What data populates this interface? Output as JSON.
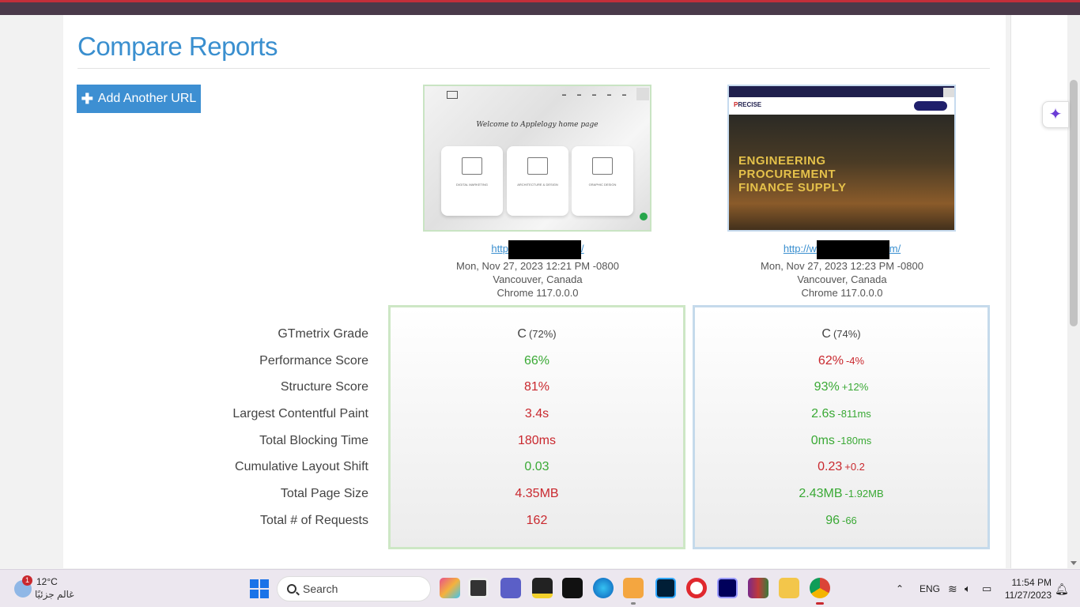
{
  "page": {
    "title": "Compare Reports",
    "add_url_label": "Add Another URL"
  },
  "reports": [
    {
      "url_prefix": "http",
      "url_suffix": "/",
      "datetime": "Mon, Nov 27, 2023 12:21 PM -0800",
      "location": "Vancouver, Canada",
      "browser": "Chrome 117.0.0.0",
      "thumbnail": {
        "headline": "Welcome to Applelogy home page",
        "cards": [
          "DIGITAL MARKETING",
          "ARCHITECTURE & DESIGN",
          "GRAPHIC DESIGN"
        ]
      }
    },
    {
      "url_prefix": "http://w",
      "url_suffix": "m/",
      "datetime": "Mon, Nov 27, 2023 12:23 PM -0800",
      "location": "Vancouver, Canada",
      "browser": "Chrome 117.0.0.0",
      "thumbnail": {
        "logo_a": "P",
        "logo_b": "RECISE",
        "headline_1": "ENGINEERING",
        "headline_2": "PROCUREMENT",
        "headline_3": "FINANCE SUPPLY"
      }
    }
  ],
  "metrics": {
    "labels": [
      "GTmetrix Grade",
      "Performance Score",
      "Structure Score",
      "Largest Contentful Paint",
      "Total Blocking Time",
      "Cumulative Layout Shift",
      "Total Page Size",
      "Total # of Requests"
    ],
    "report1": [
      {
        "value": "C",
        "extra": "(72%)",
        "status": "neutral"
      },
      {
        "value": "66%",
        "status": "good"
      },
      {
        "value": "81%",
        "status": "bad"
      },
      {
        "value": "3.4s",
        "status": "bad"
      },
      {
        "value": "180ms",
        "status": "bad"
      },
      {
        "value": "0.03",
        "status": "good"
      },
      {
        "value": "4.35MB",
        "status": "bad"
      },
      {
        "value": "162",
        "status": "bad"
      }
    ],
    "report2": [
      {
        "value": "C",
        "extra": "(74%)",
        "status": "neutral"
      },
      {
        "value": "62%",
        "delta": "-4%",
        "status": "bad"
      },
      {
        "value": "93%",
        "delta": "+12%",
        "status": "good"
      },
      {
        "value": "2.6s",
        "delta": "-811ms",
        "status": "good"
      },
      {
        "value": "0ms",
        "delta": "-180ms",
        "status": "good"
      },
      {
        "value": "0.23",
        "delta": "+0.2",
        "status": "bad"
      },
      {
        "value": "2.43MB",
        "delta": "-1.92MB",
        "status": "good"
      },
      {
        "value": "96",
        "delta": "-66",
        "status": "good"
      }
    ]
  },
  "colors": {
    "accent": "#3a8fcf",
    "good": "#3aa935",
    "bad": "#c9282e",
    "button": "#3d8fd2"
  },
  "taskbar": {
    "weather_temp": "12°C",
    "weather_cond": "غالم جزئيًا",
    "weather_badge": "1",
    "search_label": "Search",
    "lang": "ENG",
    "time": "11:54 PM",
    "date": "11/27/2023"
  }
}
